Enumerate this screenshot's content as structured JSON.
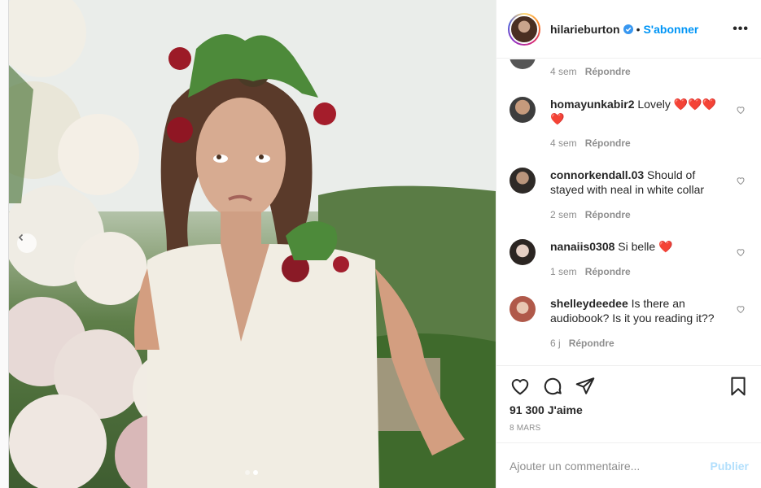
{
  "post": {
    "author": "hilarieburton",
    "follow_label": "S'abonner",
    "separator": "•",
    "more_label": "•••",
    "likes_text": "91 300 J'aime",
    "date_text": "8 MARS",
    "comment_placeholder": "Ajouter un commentaire...",
    "publish_label": "Publier"
  },
  "comments": [
    {
      "user": "",
      "text": "",
      "time": "4 sem",
      "reply": "Répondre"
    },
    {
      "user": "homayunkabir2",
      "text": "Lovely ❤️❤️❤️❤️",
      "time": "4 sem",
      "reply": "Répondre"
    },
    {
      "user": "connorkendall.03",
      "text": "Should of stayed with neal in white collar",
      "time": "2 sem",
      "reply": "Répondre"
    },
    {
      "user": "nanaiis0308",
      "text": "Si belle ❤️",
      "time": "1 sem",
      "reply": "Répondre"
    },
    {
      "user": "shelleydeedee",
      "text": "Is there an audiobook? Is it you reading it??",
      "time": "6 j",
      "reply": "Répondre"
    }
  ],
  "icons": {
    "like": "heart-icon",
    "comment": "comment-bubble-icon",
    "share": "paper-plane-icon",
    "save": "bookmark-icon",
    "verified": "verified-badge-icon",
    "prev": "chevron-left-icon"
  },
  "colors": {
    "accent": "#0095f6",
    "muted": "#8e8e8e",
    "publish_disabled": "#b2dffc",
    "heart_red": "#ed4956"
  }
}
